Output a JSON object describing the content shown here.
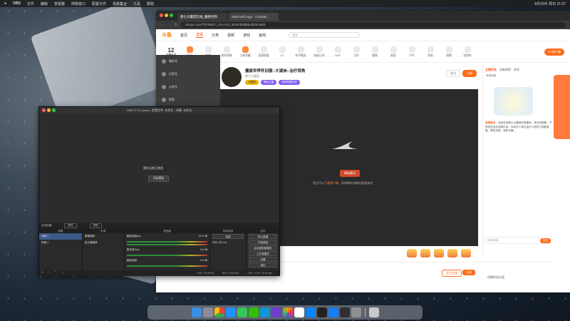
{
  "menubar": {
    "apple": "",
    "app": "OBS",
    "items": [
      "文件",
      "编辑",
      "查看器",
      "停靠窗口",
      "配置文件",
      "场景集合",
      "工具",
      "帮助"
    ],
    "right": [
      "",
      "",
      "",
      "",
      "",
      "",
      "8月29日 周日 21:37"
    ]
  },
  "browser": {
    "tabs": [
      "唐七大蘑菇在线_魔兽世界..",
      "StarCraft Logo - Cocktail ..."
    ],
    "url": "douyu.com/7074661?_c3=cm3_4015cf0d5b5cd23c1600",
    "nav": {
      "logo": "斗鱼",
      "items": [
        "首页",
        "直播",
        "分类",
        "视频",
        "游戏",
        "鱼吧"
      ],
      "search": "搜索"
    },
    "follow_count": "12",
    "follow_label": "主播在关",
    "categories": [
      "活动",
      "鱼吧",
      "星际争霸",
      "王者荣耀",
      "英雄联盟",
      "CF",
      "和平精英",
      "穿越火线",
      "DNF",
      "主机",
      "魔兽",
      "颜值",
      "户外",
      "体育",
      "棋牌",
      "游戏库"
    ],
    "pt_button": "PC客户端"
  },
  "room": {
    "title": "魔兽世界怀旧服--大湖洲--治疗视角",
    "category": "魔兽",
    "subtitle": "唐七大蘑菇",
    "tags": [
      "大蘑菇",
      "情侣主播",
      "英雄联盟优质"
    ],
    "actions": [
      "关注",
      "订阅"
    ],
    "share": "分享",
    "report": "举报"
  },
  "player": {
    "btn": "刷新重试",
    "msg_prefix": "您还可以",
    "msg_link": "下载客户端",
    "msg_suffix": "，获得畅快流畅的观看体验"
  },
  "gifts_recharge": "充值",
  "rpanel": {
    "tabs": [
      "主播任务",
      "贡献周榜",
      "贵宾"
    ],
    "label": "系统消息",
    "notice_label": "系统提示：",
    "notice": "欢迎来到唐七大蘑菇的直播间，请文明观看，严禁发布违法违规内容，未成年人请在监护人陪同下观看直播，理性消费，谨防诈骗。",
    "input": "发送弹幕",
    "send": "发送"
  },
  "below": {
    "btn1": "关注主播",
    "btn2": "订阅",
    "watch": "热播的鱼丸值"
  },
  "chat": [
    "微信号",
    "抖音号",
    "斗鱼号",
    "探索"
  ],
  "notif": "...........",
  "obs": {
    "title": "OBS 27.0.1 (mac) - 配置文件: 未命名 - 场景: 未命名",
    "preview_text": "预览当前已禁用",
    "preview_btn": "开启预览",
    "scene_label": "未选择源",
    "props": "属性",
    "filters": "滤镜",
    "docks": {
      "scenes": {
        "header": "场景",
        "rows": [
          "场景 2",
          "场景 3"
        ]
      },
      "sources": {
        "header": "来源",
        "rows": [
          "屏幕捕获",
          "显示器捕获"
        ]
      },
      "mixer": {
        "header": "混音器",
        "rows": [
          "桌面音频Aux",
          "麦克风/Aux",
          "桌面音频"
        ],
        "levels": [
          "-29.9 dB",
          "0.0 dB",
          "0.0 dB"
        ]
      },
      "transitions": {
        "header": "转场特效",
        "mode": "渐变",
        "duration_label": "时长",
        "duration": "300 ms"
      },
      "controls": {
        "header": "控件",
        "buttons": [
          "停止直播",
          "开始录制",
          "启动虚拟摄像机",
          "工作室模式",
          "设置",
          "退出"
        ]
      }
    },
    "status": {
      "live": "LIVE: 00:00:00",
      "rec": "REC: 00:00:00",
      "cpu": "CPU: 4.2%, 30.00 fps"
    }
  },
  "dock": {
    "apps": [
      "Finder",
      "Launchpad",
      "Chrome",
      "Safari",
      "Messages",
      "WeChat",
      "QQ",
      "GitHub",
      "Photos",
      "Calendar",
      "App Store",
      "Terminal",
      "Xcode",
      "OBS",
      "System Preferences",
      "Trash"
    ]
  }
}
